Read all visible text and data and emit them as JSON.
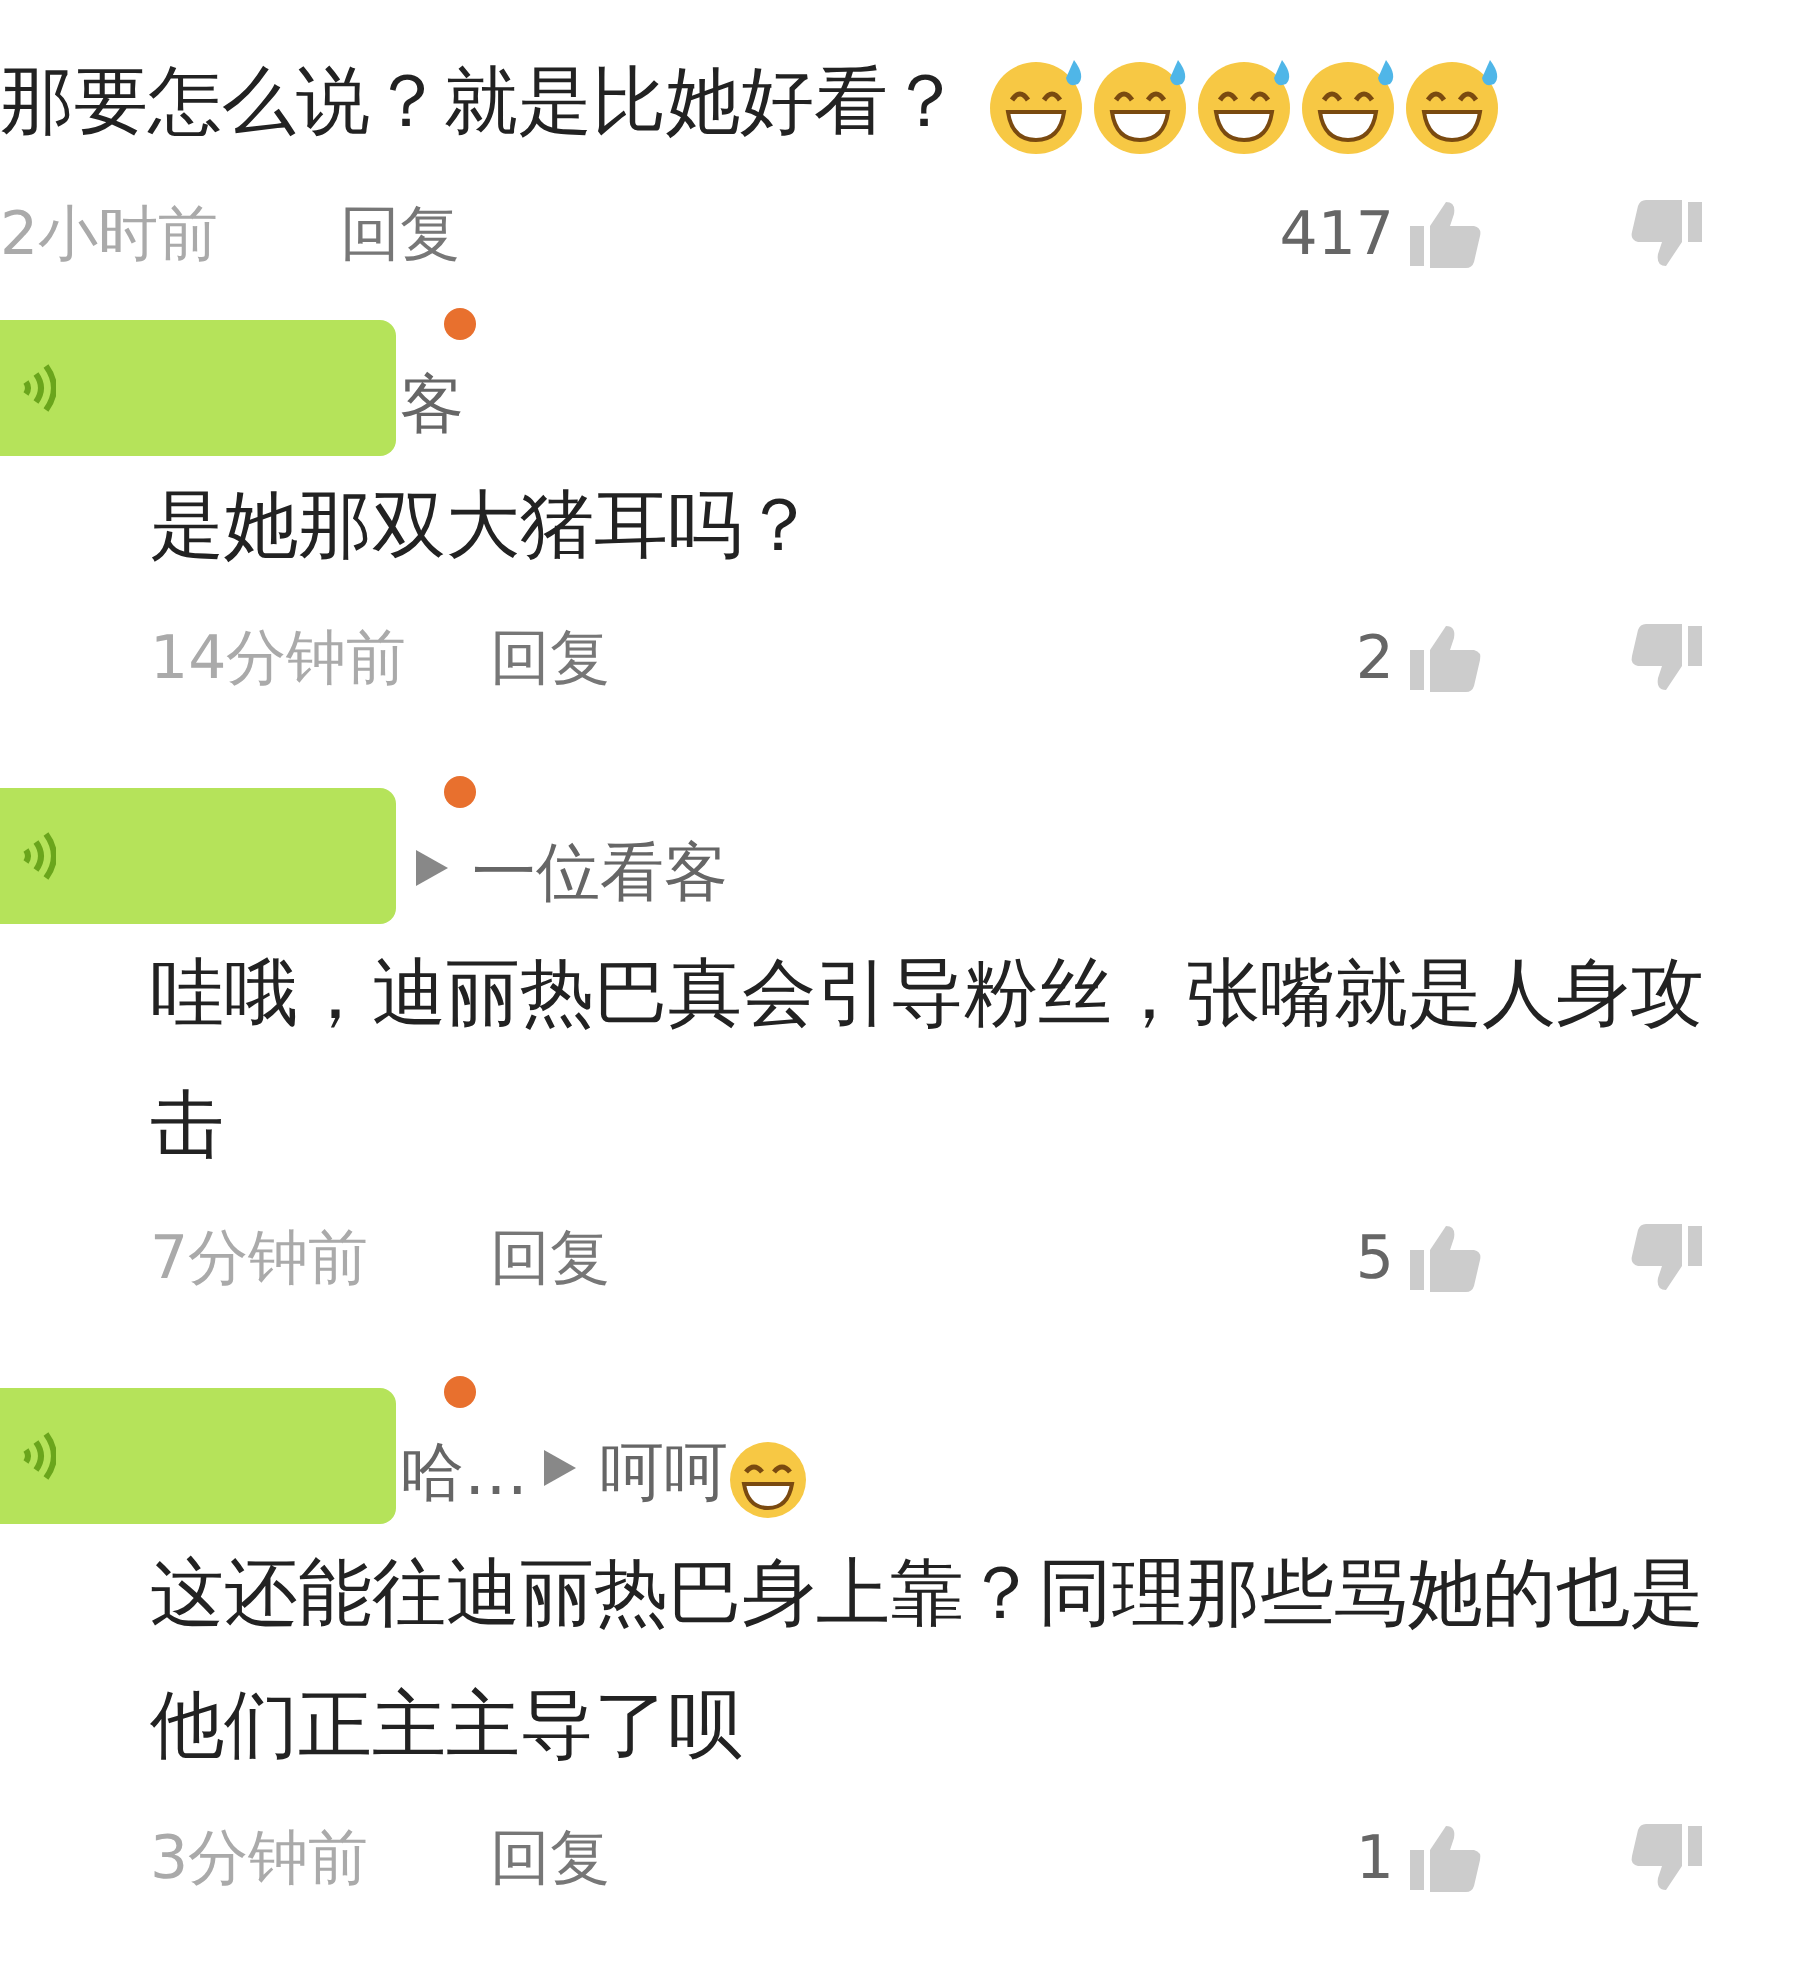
{
  "comments": [
    {
      "kind": "top",
      "text": "那要怎么说？就是比她好看？",
      "emojis": [
        {
          "kind": "sweat-grin"
        },
        {
          "kind": "sweat-grin"
        },
        {
          "kind": "sweat-grin"
        },
        {
          "kind": "sweat-grin"
        },
        {
          "kind": "sweat-grin"
        }
      ],
      "time": "2小时前",
      "reply_label": "回复",
      "likes": "417"
    },
    {
      "kind": "reply",
      "sticker": true,
      "user": "客",
      "text": "是她那双大猪耳吗？",
      "time": "14分钟前",
      "reply_label": "回复",
      "likes": "2"
    },
    {
      "kind": "reply",
      "sticker": true,
      "reply_to": "一位看客",
      "text": "哇哦，迪丽热巴真会引导粉丝，张嘴就是人身攻击",
      "time": "7分钟前",
      "reply_label": "回复",
      "likes": "5"
    },
    {
      "kind": "reply",
      "sticker": true,
      "user": "哈…",
      "reply_to": "呵呵",
      "reply_to_emojis": [
        {
          "kind": "laugh"
        }
      ],
      "text": "这还能往迪丽热巴身上靠？同理那些骂她的也是他们正主主导了呗",
      "time": "3分钟前",
      "reply_label": "回复",
      "likes": "1"
    }
  ]
}
